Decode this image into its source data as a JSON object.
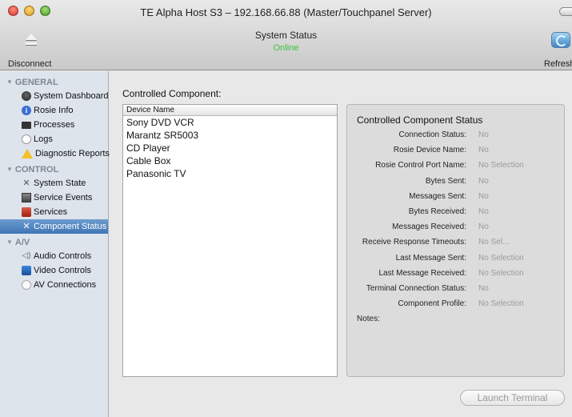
{
  "window": {
    "title": "TE Alpha Host S3 – 192.168.66.88 (Master/Touchpanel Server)"
  },
  "toolbar": {
    "title": "System Status",
    "status": "Online",
    "status_color": "#3ec33e",
    "disconnect_label": "Disconnect",
    "refresh_label": "Refresh"
  },
  "sidebar": {
    "sections": [
      {
        "label": "GENERAL",
        "items": [
          {
            "label": "System Dashboard",
            "icon": "dashboard-icon"
          },
          {
            "label": "Rosie Info",
            "icon": "info-icon"
          },
          {
            "label": "Processes",
            "icon": "processes-icon"
          },
          {
            "label": "Logs",
            "icon": "logs-icon"
          },
          {
            "label": "Diagnostic Reports",
            "icon": "warning-icon"
          }
        ]
      },
      {
        "label": "CONTROL",
        "items": [
          {
            "label": "System State",
            "icon": "tools-icon"
          },
          {
            "label": "Service Events",
            "icon": "events-icon"
          },
          {
            "label": "Services",
            "icon": "services-icon"
          },
          {
            "label": "Component Status",
            "icon": "tools-icon",
            "selected": true
          }
        ]
      },
      {
        "label": "A/V",
        "items": [
          {
            "label": "Audio Controls",
            "icon": "speaker-icon"
          },
          {
            "label": "Video Controls",
            "icon": "video-icon"
          },
          {
            "label": "AV Connections",
            "icon": "av-connections-icon"
          }
        ]
      }
    ]
  },
  "main": {
    "controlled_component_label": "Controlled Component:",
    "device_list": {
      "header": "Device Name",
      "rows": [
        "Sony DVD VCR",
        "Marantz SR5003",
        "CD Player",
        "Cable Box",
        "Panasonic TV"
      ]
    },
    "status": {
      "title": "Controlled Component Status",
      "rows": [
        {
          "key": "Connection Status:",
          "value": "No"
        },
        {
          "key": "Rosie Device Name:",
          "value": "No"
        },
        {
          "key": "Rosie Control Port Name:",
          "value": "No Selection"
        },
        {
          "key": "Bytes Sent:",
          "value": "No"
        },
        {
          "key": "Messages Sent:",
          "value": "No"
        },
        {
          "key": "Bytes Received:",
          "value": "No"
        },
        {
          "key": "Messages Received:",
          "value": "No"
        },
        {
          "key": "Receive Response Timeouts:",
          "value": "No Sel..."
        },
        {
          "key": "Last Message Sent:",
          "value": "No Selection"
        },
        {
          "key": "Last Message Received:",
          "value": "No Selection"
        },
        {
          "key": "Terminal Connection Status:",
          "value": "No"
        },
        {
          "key": "Component Profile:",
          "value": "No Selection"
        }
      ],
      "notes_label": "Notes:"
    },
    "launch_terminal_label": "Launch Terminal"
  }
}
